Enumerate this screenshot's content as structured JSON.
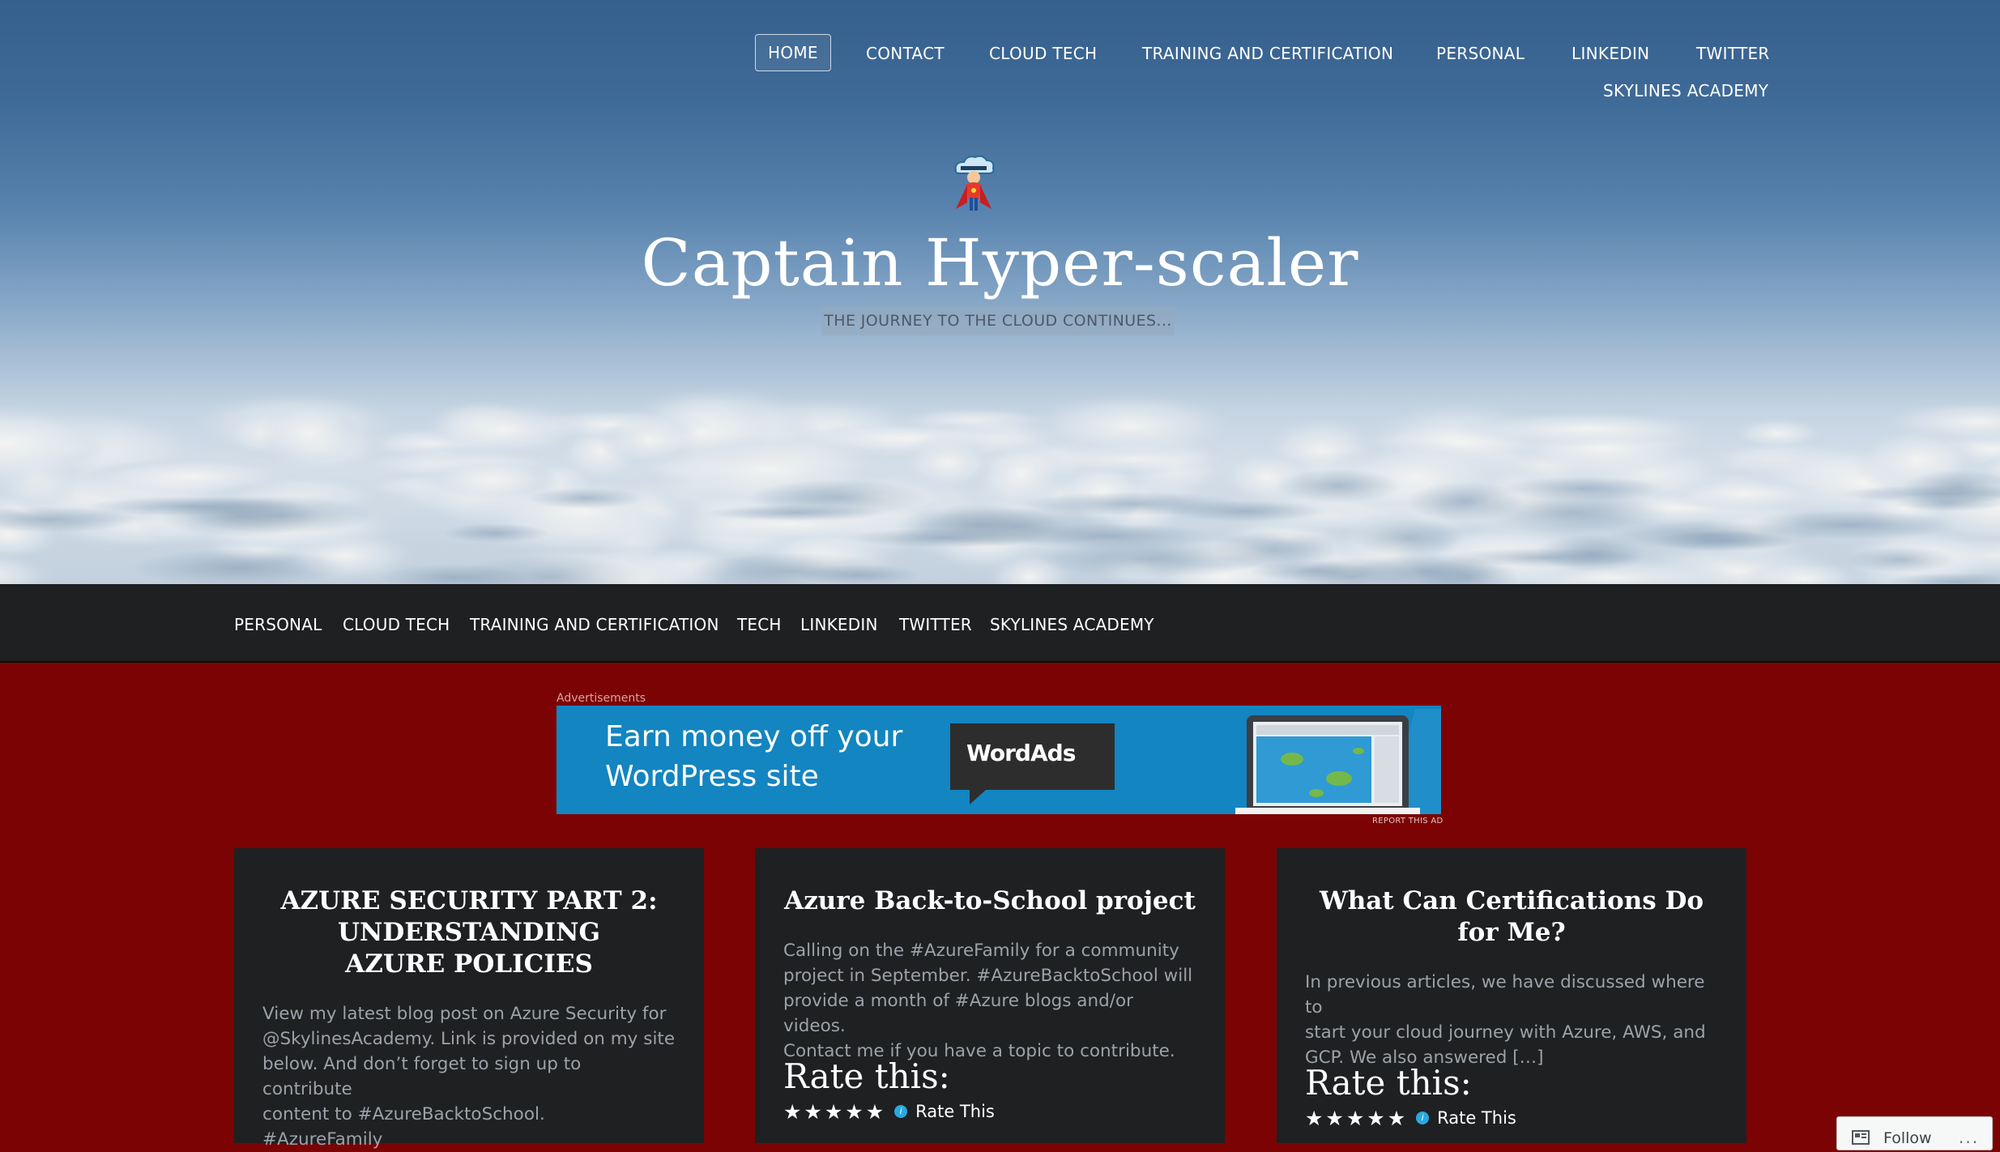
{
  "header": {
    "nav": [
      "HOME",
      "CONTACT",
      "CLOUD TECH",
      "TRAINING AND CERTIFICATION",
      "PERSONAL",
      "LINKEDIN",
      "TWITTER",
      "SKYLINES ACADEMY"
    ],
    "active_nav": "HOME",
    "site_title": "Captain Hyper-scaler",
    "tagline": "THE JOURNEY TO THE CLOUD CONTINUES..."
  },
  "menu": [
    "PERSONAL",
    "CLOUD TECH",
    "TRAINING AND CERTIFICATION",
    "TECH",
    "LINKEDIN",
    "TWITTER",
    "SKYLINES ACADEMY"
  ],
  "ad": {
    "label": "Advertisements",
    "headline_line1": "Earn money off your",
    "headline_line2": "WordPress site",
    "brand": "WordAds",
    "report": "REPORT THIS AD",
    "bg_color": "#1385c1"
  },
  "posts": [
    {
      "title_lines": [
        "AZURE SECURITY PART 2:",
        "UNDERSTANDING",
        "AZURE POLICIES"
      ],
      "excerpt_lines": [
        "View my latest blog post on Azure Security for",
        "@SkylinesAcademy. Link is provided on my site",
        "below. And don’t forget to sign up to contribute",
        "content to #AzureBacktoSchool.",
        "#AzureFamily"
      ]
    },
    {
      "title_lines": [
        "Azure Back-to-School project"
      ],
      "excerpt_lines": [
        "Calling on the #AzureFamily for a community",
        "project in September. #AzureBacktoSchool will",
        "provide a month of #Azure blogs and/or videos.",
        "Contact me if you have a topic to contribute."
      ],
      "rate_heading": "Rate this:",
      "rate_label": "Rate This"
    },
    {
      "title_lines": [
        "What Can Certifications Do",
        "for Me?"
      ],
      "excerpt_lines": [
        "In previous articles, we have discussed where to",
        "start your cloud journey with Azure, AWS, and",
        "GCP. We also answered […]"
      ],
      "rate_heading": "Rate this:",
      "rate_label": "Rate This"
    }
  ],
  "follow": {
    "label": "Follow",
    "more": "..."
  },
  "colors": {
    "page_bg": "#7b0303",
    "menu_bar": "#1e2022",
    "card_bg": "#1e2022"
  }
}
